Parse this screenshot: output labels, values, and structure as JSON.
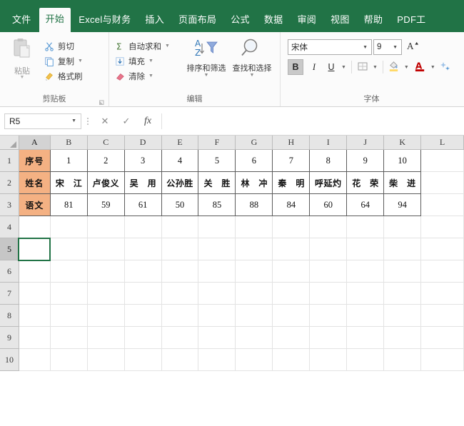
{
  "app": {
    "accent_green": "#217346",
    "header_fill": "#f4b183"
  },
  "tabs": [
    {
      "label": "文件",
      "active": false
    },
    {
      "label": "开始",
      "active": true
    },
    {
      "label": "Excel与财务",
      "active": false
    },
    {
      "label": "插入",
      "active": false
    },
    {
      "label": "页面布局",
      "active": false
    },
    {
      "label": "公式",
      "active": false
    },
    {
      "label": "数据",
      "active": false
    },
    {
      "label": "审阅",
      "active": false
    },
    {
      "label": "视图",
      "active": false
    },
    {
      "label": "帮助",
      "active": false
    },
    {
      "label": "PDF工",
      "active": false
    }
  ],
  "ribbon": {
    "clipboard": {
      "group_label": "剪贴板",
      "paste_label": "粘贴",
      "commands": [
        {
          "label": "剪切",
          "icon": "scissors-icon",
          "has_caret": false
        },
        {
          "label": "复制",
          "icon": "copy-icon",
          "has_caret": true
        },
        {
          "label": "格式刷",
          "icon": "format-painter-icon",
          "has_caret": false
        }
      ]
    },
    "editing": {
      "group_label": "编辑",
      "commands": [
        {
          "label": "自动求和",
          "icon": "sigma-icon",
          "has_caret": true
        },
        {
          "label": "填充",
          "icon": "fill-down-icon",
          "has_caret": true
        },
        {
          "label": "清除",
          "icon": "eraser-icon",
          "has_caret": true
        }
      ],
      "big_buttons": [
        {
          "label": "排序和筛选",
          "icon": "sort-filter-icon"
        },
        {
          "label": "查找和选择",
          "icon": "magnifier-icon"
        }
      ]
    },
    "font": {
      "group_label": "字体",
      "font_name": "宋体",
      "font_size": "9",
      "grow_font_icon": "grow-font-icon",
      "bold_label": "B",
      "italic_label": "I",
      "underline_label": "U",
      "bold_active": true,
      "borders_icon": "borders-icon",
      "fill_color_icon": "fill-color-icon",
      "font_color_icon": "font-color-icon",
      "fill_color_swatch": "#ffd966",
      "font_color_swatch": "#c00000"
    }
  },
  "formula_bar": {
    "name_box_value": "R5",
    "cancel_icon": "cancel-icon",
    "confirm_icon": "confirm-icon",
    "function_icon": "fx-icon",
    "formula_value": ""
  },
  "sheet": {
    "column_headers": [
      "A",
      "B",
      "C",
      "D",
      "E",
      "F",
      "G",
      "H",
      "I",
      "J",
      "K",
      "L"
    ],
    "row_headers": [
      "1",
      "2",
      "3",
      "4",
      "5",
      "6",
      "7",
      "8",
      "9",
      "10"
    ],
    "selected_cell": "A5",
    "selected_row": "5",
    "selected_column": "A",
    "row_labels": [
      "序号",
      "姓名",
      "语文"
    ],
    "ids": [
      "1",
      "2",
      "3",
      "4",
      "5",
      "6",
      "7",
      "8",
      "9",
      "10"
    ],
    "names": [
      "宋江",
      "卢俊义",
      "吴用",
      "公孙胜",
      "关胜",
      "林冲",
      "秦明",
      "呼延灼",
      "花荣",
      "柴进"
    ],
    "scores": [
      "81",
      "59",
      "61",
      "50",
      "85",
      "88",
      "84",
      "60",
      "64",
      "94"
    ]
  }
}
